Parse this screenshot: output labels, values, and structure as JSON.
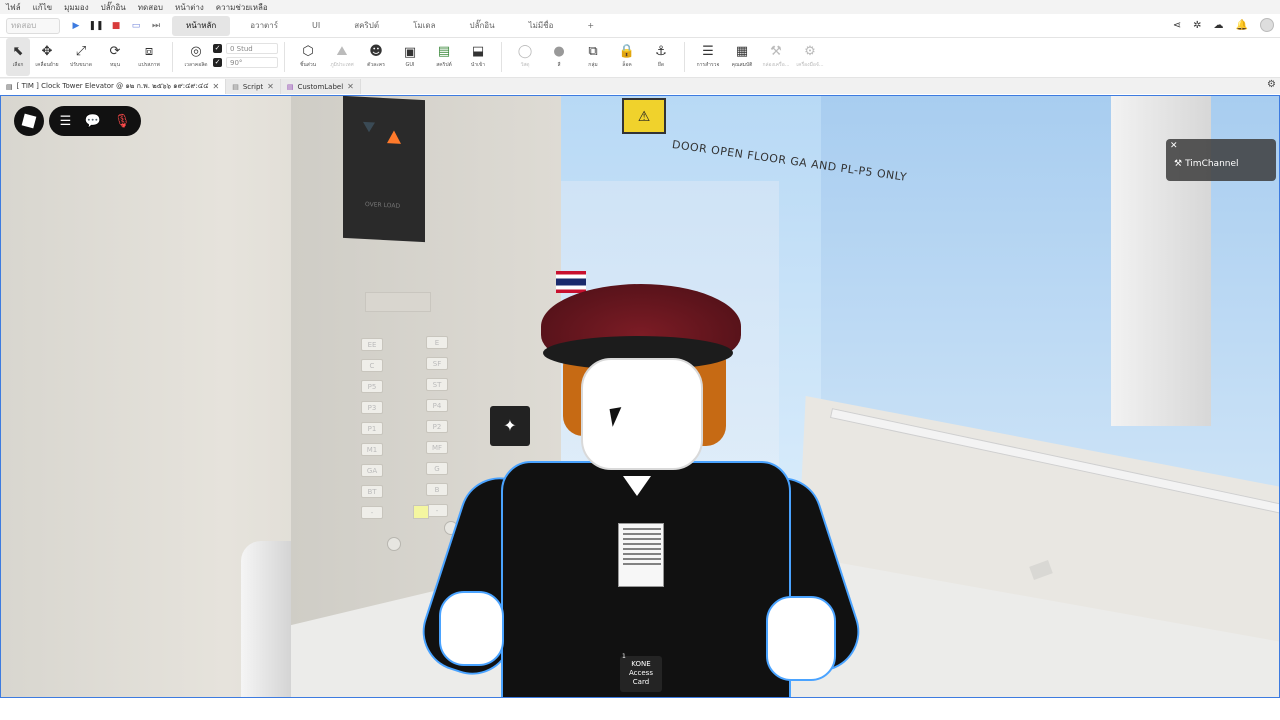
{
  "menu": {
    "items": [
      "ไฟล์",
      "แก้ไข",
      "มุมมอง",
      "ปลั๊กอิน",
      "ทดสอบ",
      "หน้าต่าง",
      "ความช่วยเหลือ"
    ]
  },
  "ribbon": {
    "mode_select": "ทดสอบ",
    "tabs": [
      "หน้าหลัก",
      "อวาตาร์",
      "UI",
      "สคริปต์",
      "โมเดล",
      "ปลั๊กอิน",
      "ไม่มีชื่อ",
      "+"
    ],
    "active_tab": "หน้าหลัก"
  },
  "toolbar": {
    "tools": [
      {
        "label": "เลือก",
        "icon": "cursor-icon",
        "glyph": "⬉"
      },
      {
        "label": "เคลื่อนย้าย",
        "icon": "move-icon",
        "glyph": "✥"
      },
      {
        "label": "ปรับขนาด",
        "icon": "scale-icon",
        "glyph": "⤢"
      },
      {
        "label": "หมุน",
        "icon": "rotate-icon",
        "glyph": "⟳"
      },
      {
        "label": "แปรสภาพ",
        "icon": "transform-icon",
        "glyph": "⧈"
      },
      {
        "label": "เวลาคอลิด",
        "icon": "collision-icon",
        "glyph": "◎"
      }
    ],
    "snap": {
      "move_value": "0 Stud",
      "rotate_value": "90°"
    },
    "tools2": [
      {
        "label": "ชิ้นส่วน",
        "icon": "part-icon",
        "glyph": "⬡"
      },
      {
        "label": "ภูมิประเทศ",
        "icon": "terrain-icon",
        "glyph": "⛰"
      },
      {
        "label": "ตัวละคร",
        "icon": "character-icon",
        "glyph": "☻"
      },
      {
        "label": "GUI",
        "icon": "gui-icon",
        "glyph": "▣"
      },
      {
        "label": "สคริปต์",
        "icon": "script-icon",
        "glyph": "▤"
      },
      {
        "label": "นำเข้า",
        "icon": "import-icon",
        "glyph": "⬓"
      }
    ],
    "tools3": [
      {
        "label": "วัสดุ",
        "icon": "material-icon",
        "glyph": "◯"
      },
      {
        "label": "สี",
        "icon": "color-icon",
        "glyph": "●"
      },
      {
        "label": "กลุ่ม",
        "icon": "group-icon",
        "glyph": "⧉"
      },
      {
        "label": "ล็อค",
        "icon": "lock-icon",
        "glyph": "🔒"
      },
      {
        "label": "ยึด",
        "icon": "anchor-icon",
        "glyph": "⚓"
      }
    ],
    "tools4": [
      {
        "label": "การสำรวจ",
        "icon": "explorer-icon",
        "glyph": "☰"
      },
      {
        "label": "คุณสมบัติ",
        "icon": "properties-icon",
        "glyph": "▦"
      },
      {
        "label": "กล่องเครื่อ...",
        "icon": "toolbox-icon",
        "glyph": "⚒"
      },
      {
        "label": "เครื่องมือจั...",
        "icon": "manager-icon",
        "glyph": "⚙"
      }
    ]
  },
  "doc_tabs": [
    {
      "label": "[ TIM ] Clock Tower Elevator @ ๑๒ ก.พ. ๒๕๖๖ ๑๙:๔๙:๔๔",
      "active": true
    },
    {
      "label": "Script",
      "active": false
    },
    {
      "label": "CustomLabel",
      "active": false
    }
  ],
  "viewport": {
    "door_sign_text": "DOOR OPEN FLOOR GA AND PL-P5 ONLY",
    "display_text": "OVER LOAD",
    "floor_buttons_left": [
      "EE",
      "C",
      "P5",
      "P3",
      "P1",
      "M1",
      "GA",
      "BT",
      "-"
    ],
    "floor_buttons_right": [
      "E",
      "SF",
      "ST",
      "P4",
      "P2",
      "MF",
      "G",
      "B",
      "-"
    ],
    "badge_card_label": "KONE Access Card",
    "badge_card_count": "1",
    "channel_name": "TimChannel"
  },
  "colors": {
    "accent_blue": "#3d7be0",
    "outline_blue": "#4aa3ff",
    "display_arrow": "#ff7a2b"
  }
}
